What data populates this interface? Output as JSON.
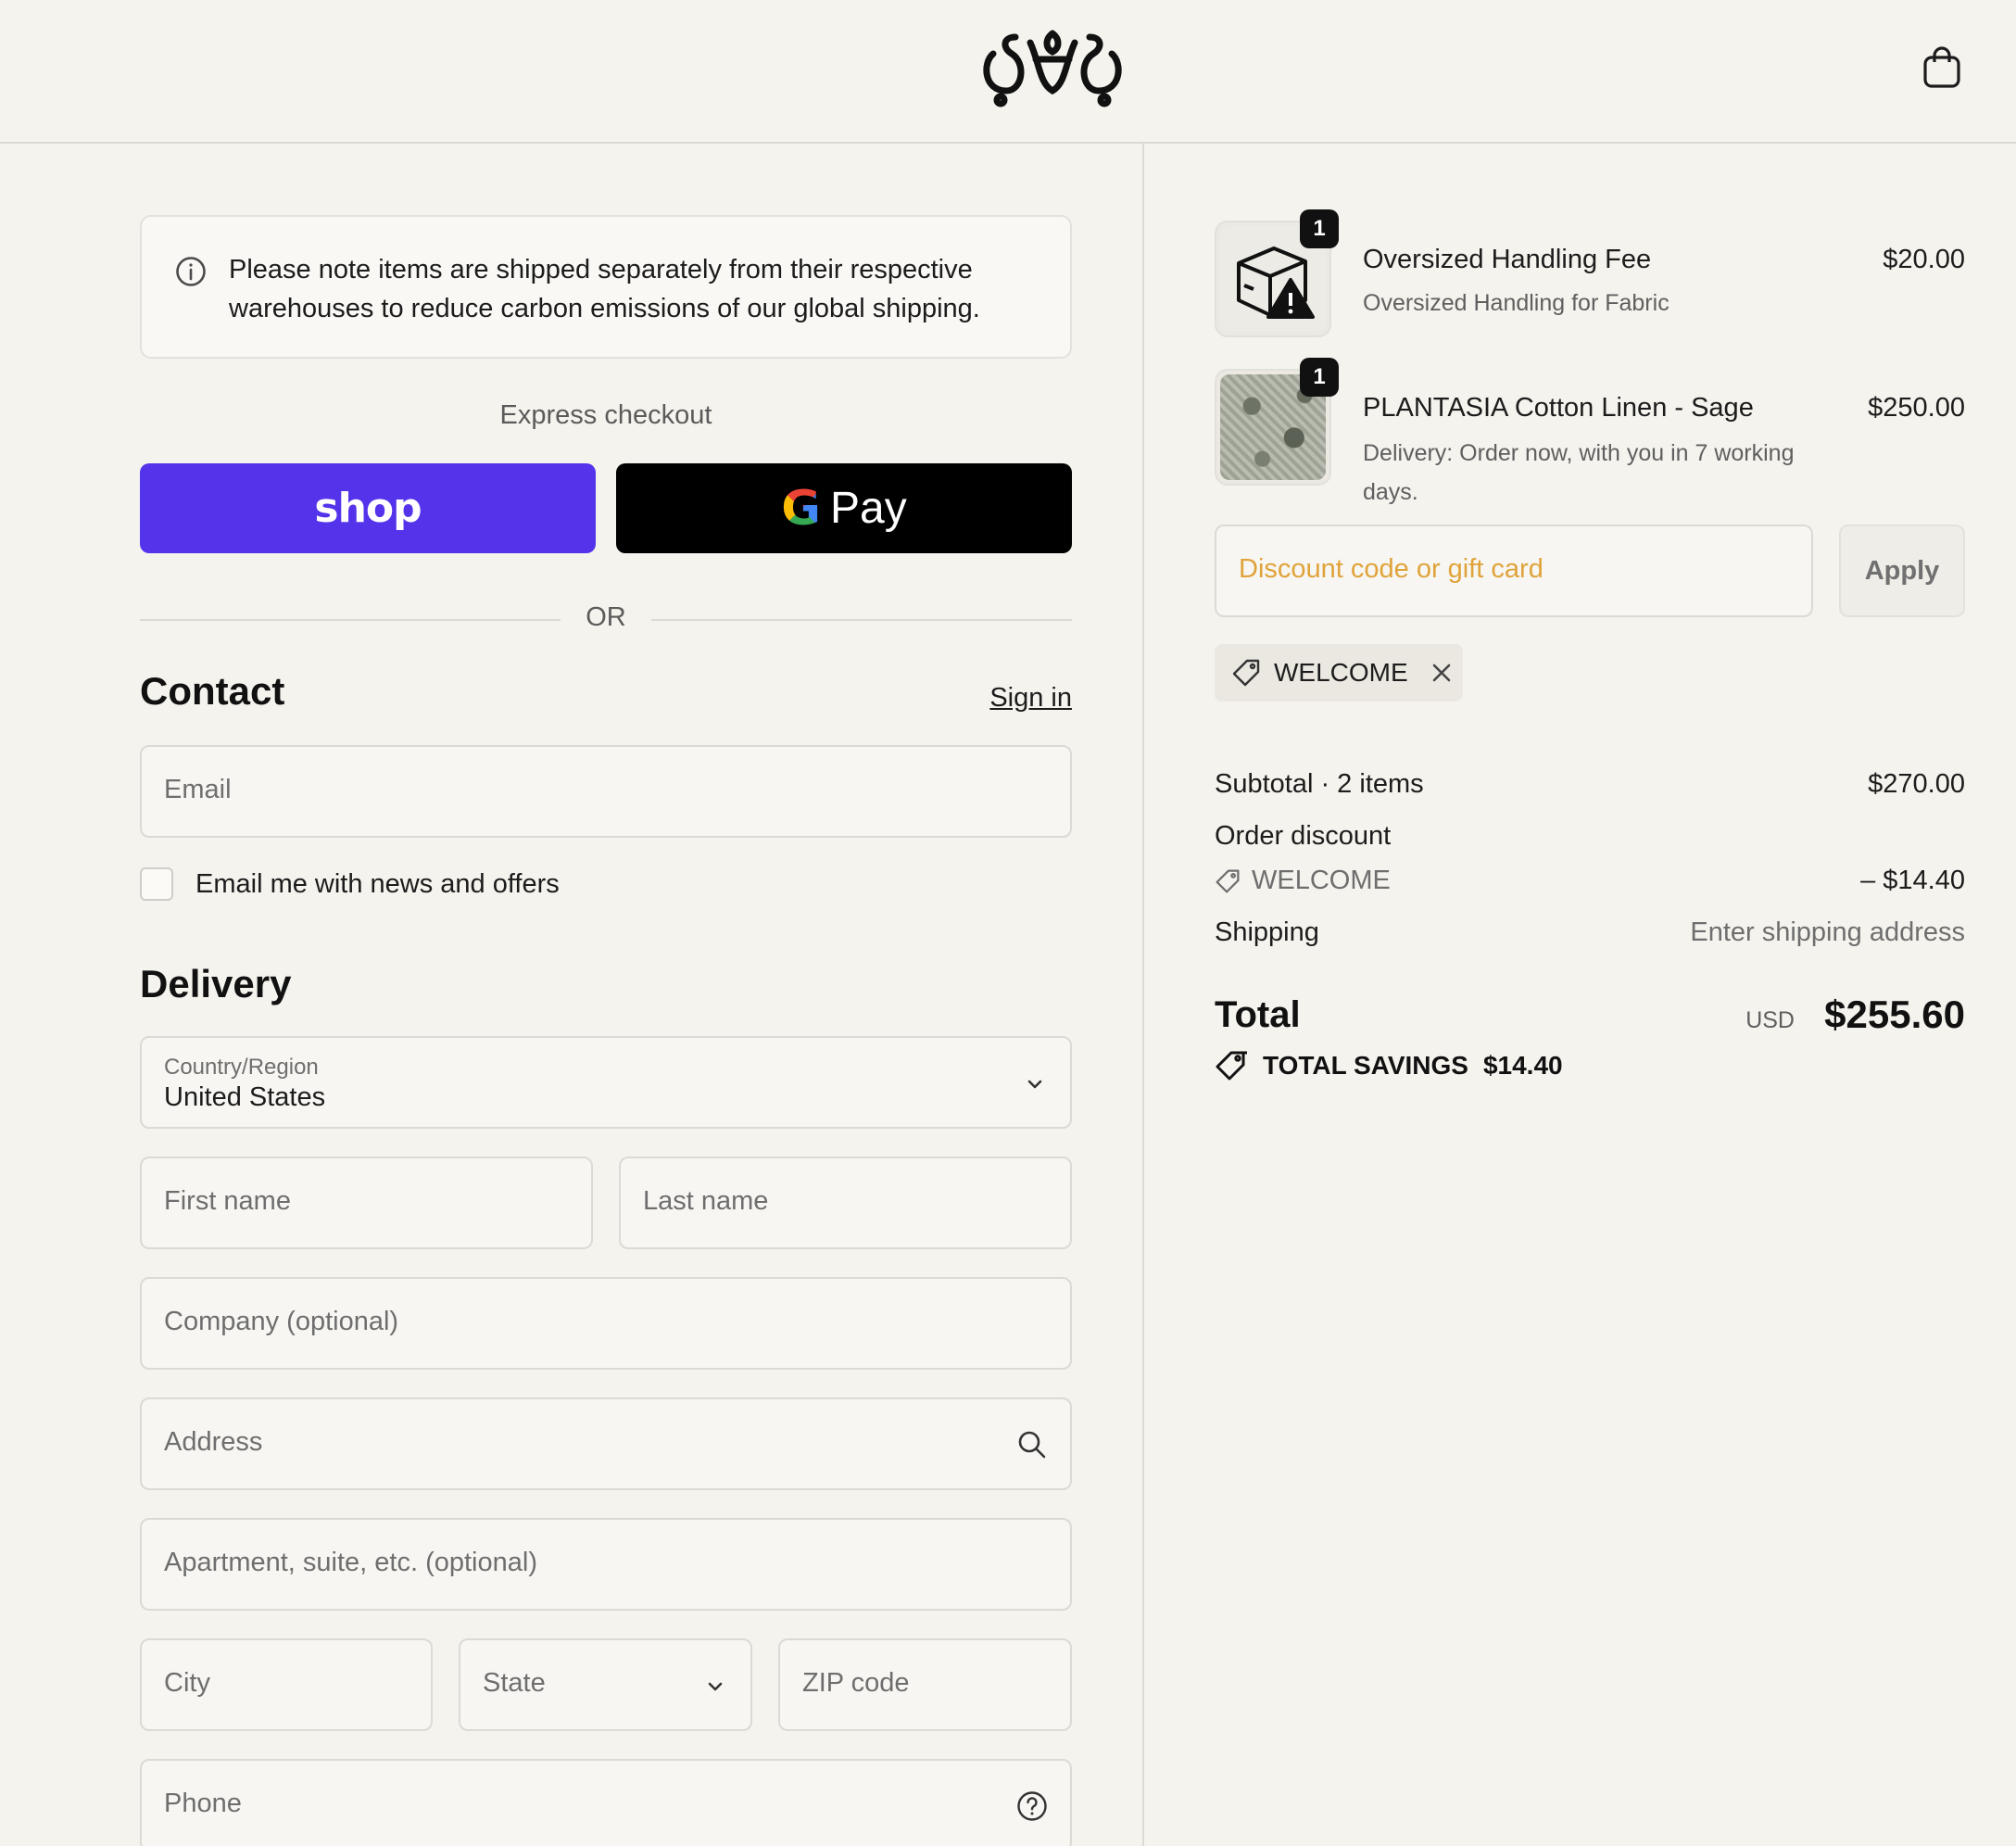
{
  "header": {
    "logo_alt": "Tenereteam",
    "cart_icon": "shopping-bag-icon"
  },
  "notice": {
    "icon": "info-icon",
    "text": "Please note items are shipped separately from their respective warehouses to reduce carbon emissions of our global shipping."
  },
  "express": {
    "label": "Express checkout",
    "shop_label": "shop",
    "gpay_g": "G",
    "gpay_label": "Pay",
    "or_label": "OR"
  },
  "contact": {
    "title": "Contact",
    "signin_label": "Sign in",
    "email_placeholder": "Email",
    "newsletter_label": "Email me with news and offers",
    "newsletter_checked": false
  },
  "delivery": {
    "title": "Delivery",
    "country_label": "Country/Region",
    "country_value": "United States",
    "first_name_placeholder": "First name",
    "last_name_placeholder": "Last name",
    "company_placeholder": "Company (optional)",
    "address_placeholder": "Address",
    "apartment_placeholder": "Apartment, suite, etc. (optional)",
    "city_placeholder": "City",
    "state_placeholder": "State",
    "zip_placeholder": "ZIP code",
    "phone_placeholder": "Phone"
  },
  "order": {
    "items": [
      {
        "quantity": "1",
        "name": "Oversized Handling Fee",
        "subtitle": "Oversized Handling for Fabric",
        "price": "$20.00",
        "thumb_icon": "package-warning-icon"
      },
      {
        "quantity": "1",
        "name": "PLANTASIA Cotton Linen - Sage",
        "subtitle": "Delivery: Order now, with you in 7 working days.",
        "price": "$250.00",
        "thumb_icon": "fabric-swatch-image"
      }
    ],
    "discount_placeholder": "Discount code or gift card",
    "apply_label": "Apply",
    "applied_code": "WELCOME",
    "subtotal_label": "Subtotal · 2 items",
    "subtotal_value": "$270.00",
    "order_discount_label": "Order discount",
    "discount_code": "WELCOME",
    "discount_value": "– $14.40",
    "shipping_label": "Shipping",
    "shipping_value": "Enter shipping address",
    "total_label": "Total",
    "currency": "USD",
    "total_value": "$255.60",
    "savings_label": "TOTAL SAVINGS",
    "savings_value": "$14.40"
  },
  "colors": {
    "background": "#f5f3ee",
    "shop_pay": "#5433eb",
    "gpay": "#000000",
    "discount_placeholder": "#e0a33a"
  }
}
